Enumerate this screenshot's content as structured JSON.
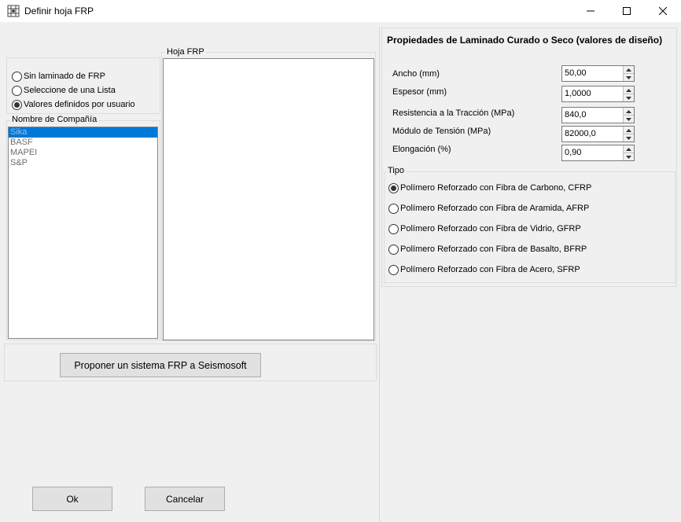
{
  "window": {
    "title": "Definir hoja FRP",
    "icons": {
      "app": "frp-grid-icon",
      "minimize": "minimize-icon",
      "maximize": "maximize-icon",
      "close": "close-icon"
    }
  },
  "left": {
    "laminate_options": [
      {
        "label": "Sin laminado de FRP",
        "checked": false
      },
      {
        "label": "Seleccione de una Lista",
        "checked": false
      },
      {
        "label": "Valores definidos por usuario",
        "checked": true
      }
    ],
    "company_group_label": "Nombre de Compañía",
    "companies": [
      {
        "label": "Sika",
        "selected": true
      },
      {
        "label": "BASF",
        "selected": false
      },
      {
        "label": "MAPEI",
        "selected": false
      },
      {
        "label": "S&P",
        "selected": false
      }
    ],
    "sheet_group_label": "Hoja FRP",
    "propose_button": "Proponer un sistema FRP a Seismosoft",
    "ok_button": "Ok",
    "cancel_button": "Cancelar"
  },
  "right": {
    "section_title": "Propiedades de Laminado Curado o Seco (valores de diseño)",
    "fields": [
      {
        "label": "Ancho (mm)",
        "value": "50,00"
      },
      {
        "label": "Espesor (mm)",
        "value": "1,0000"
      },
      {
        "label": "Resistencia a la Tracción (MPa)",
        "value": "840,0"
      },
      {
        "label": "Módulo de Tensión (MPa)",
        "value": "82000,0"
      },
      {
        "label": "Elongación (%)",
        "value": "0,90"
      }
    ],
    "type_group_label": "Tipo",
    "types": [
      {
        "label": "Polímero Reforzado con Fibra de Carbono, CFRP",
        "checked": true
      },
      {
        "label": "Polímero Reforzado con Fibra de Aramida, AFRP",
        "checked": false
      },
      {
        "label": "Polímero Reforzado con Fibra de Vidrio, GFRP",
        "checked": false
      },
      {
        "label": "Polímero Reforzado con Fibra de Basalto, BFRP",
        "checked": false
      },
      {
        "label": "Polímero Reforzado con Fibra de Acero, SFRP",
        "checked": false
      }
    ]
  }
}
